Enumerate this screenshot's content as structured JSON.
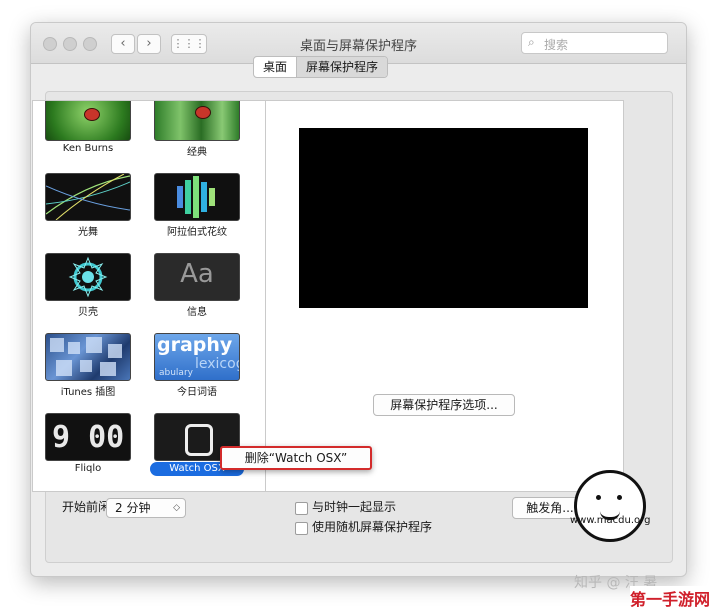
{
  "window": {
    "title": "桌面与屏幕保护程序",
    "search_placeholder": "搜索"
  },
  "tabs": [
    {
      "label": "桌面",
      "selected": false
    },
    {
      "label": "屏幕保护程序",
      "selected": true
    }
  ],
  "screensavers": [
    {
      "label": "Ken Burns",
      "icon": "ladybug-thumbnail"
    },
    {
      "label": "经典",
      "icon": "forest-thumbnail"
    },
    {
      "label": "光舞",
      "icon": "light-lines-thumbnail"
    },
    {
      "label": "阿拉伯式花纹",
      "icon": "arabesque-thumbnail"
    },
    {
      "label": "贝壳",
      "icon": "shell-thumbnail"
    },
    {
      "label": "信息",
      "icon": "message-thumbnail",
      "glyph": "Aa"
    },
    {
      "label": "iTunes 插图",
      "icon": "itunes-thumbnail"
    },
    {
      "label": "今日词语",
      "icon": "word-of-day-thumbnail",
      "glyph": "graphy",
      "glyph2": "lexicog",
      "glyph3": "abulary"
    },
    {
      "label": "Fliqlo",
      "icon": "fliqlo-clock-thumbnail",
      "glyph": "9 00"
    },
    {
      "label": "Watch OSX",
      "icon": "watch-thumbnail",
      "selected": true
    }
  ],
  "context_menu": {
    "delete_label": "删除“Watch OSX”"
  },
  "options_button": "屏幕保护程序选项...",
  "bottom": {
    "idle_label": "开始前闲置:",
    "idle_value": "2 分钟",
    "show_clock_label": "与时钟一起显示",
    "show_clock_checked": false,
    "random_label": "使用随机屏幕保护程序",
    "random_checked": false,
    "hot_corners_label": "触发角...",
    "help_label": "?"
  },
  "watermark": {
    "site": "www.macdu.org",
    "zhihu": "知乎 @ 汪 暑",
    "brand": "第一手游网"
  },
  "colors": {
    "selection": "#1b6ce0",
    "highlight_border": "#d32b2b"
  }
}
